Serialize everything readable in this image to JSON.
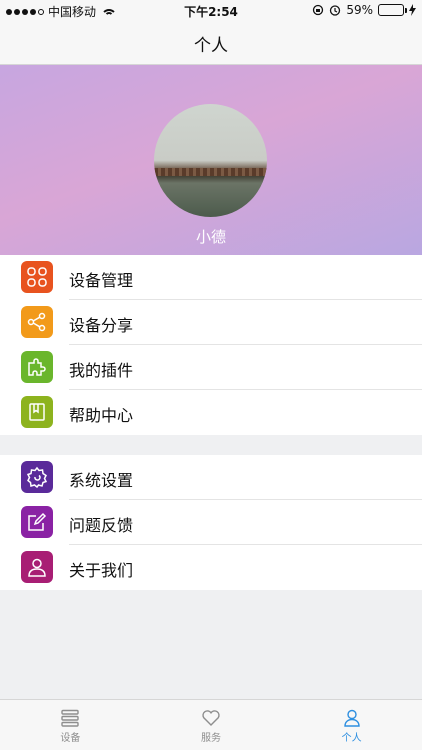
{
  "status_bar": {
    "carrier": "中国移动",
    "time": "下午2:54",
    "battery": "59%",
    "battery_level": 0.59
  },
  "nav": {
    "title": "个人"
  },
  "profile": {
    "username": "小德"
  },
  "menu": {
    "group1": [
      {
        "label": "设备管理",
        "icon": "grid-icon",
        "color": "#e8531f"
      },
      {
        "label": "设备分享",
        "icon": "share-icon",
        "color": "#f29a1a"
      },
      {
        "label": "我的插件",
        "icon": "puzzle-icon",
        "color": "#6ab62c"
      },
      {
        "label": "帮助中心",
        "icon": "book-icon",
        "color": "#8db31e"
      }
    ],
    "group2": [
      {
        "label": "系统设置",
        "icon": "gear-icon",
        "color": "#5a2a9a"
      },
      {
        "label": "问题反馈",
        "icon": "edit-icon",
        "color": "#8a22a4"
      },
      {
        "label": "关于我们",
        "icon": "user-icon",
        "color": "#a81e74"
      }
    ]
  },
  "tabs": [
    {
      "label": "设备",
      "icon": "list-icon",
      "active": false
    },
    {
      "label": "服务",
      "icon": "heart-icon",
      "active": false
    },
    {
      "label": "个人",
      "icon": "person-icon",
      "active": true
    }
  ]
}
